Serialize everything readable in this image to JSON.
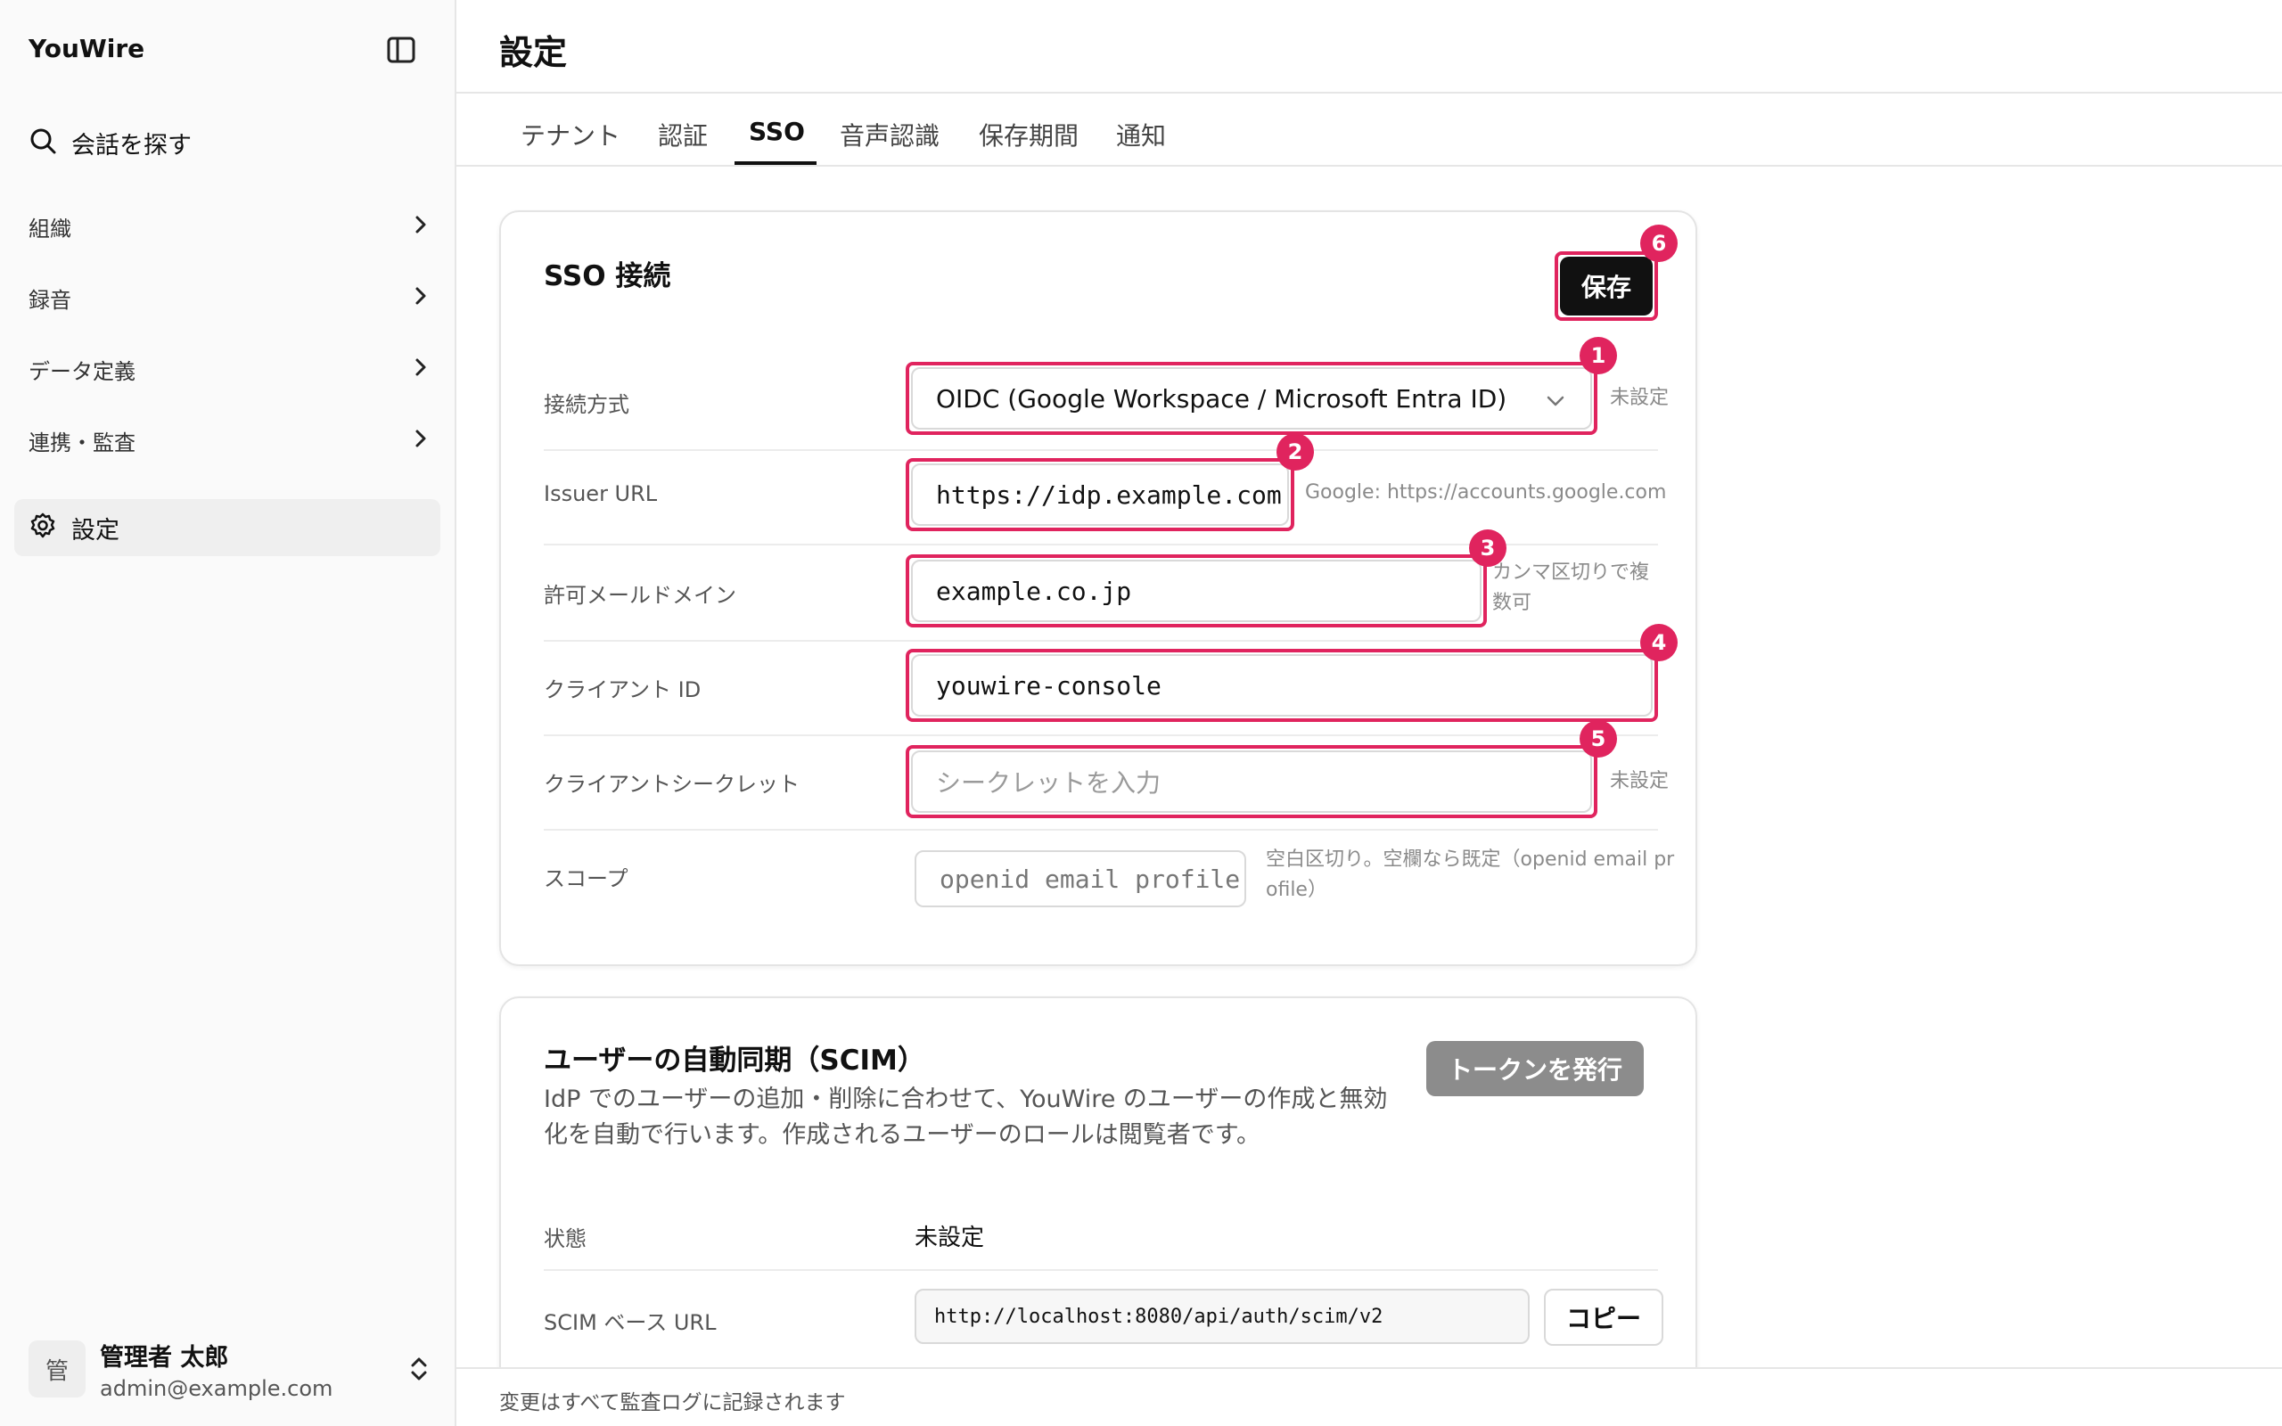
{
  "app": {
    "brand": "YouWire"
  },
  "sidebar": {
    "search_label": "会話を探す",
    "groups": [
      {
        "label": "組織"
      },
      {
        "label": "録音"
      },
      {
        "label": "データ定義"
      },
      {
        "label": "連携・監査"
      }
    ],
    "active_item": {
      "label": "設定",
      "icon": "gear-icon"
    },
    "user": {
      "avatar": "管",
      "name": "管理者 太郎",
      "email": "admin@example.com"
    }
  },
  "header": {
    "title": "設定"
  },
  "tabs": [
    {
      "label": "テナント"
    },
    {
      "label": "認証"
    },
    {
      "label": "SSO",
      "active": true
    },
    {
      "label": "音声認識"
    },
    {
      "label": "保存期間"
    },
    {
      "label": "通知"
    }
  ],
  "sso": {
    "title": "SSO 接続",
    "save_label": "保存",
    "rows": {
      "method": {
        "label": "接続方式",
        "value": "OIDC (Google Workspace / Microsoft Entra ID)",
        "hint": "未設定"
      },
      "issuer": {
        "label": "Issuer URL",
        "value": "https://idp.example.com",
        "hint": "Google: https://accounts.google.com"
      },
      "domain": {
        "label": "許可メールドメイン",
        "value": "example.co.jp",
        "hint_line1": "カンマ区切りで複",
        "hint_line2": "数可"
      },
      "client_id": {
        "label": "クライアント ID",
        "value": "youwire-console"
      },
      "secret": {
        "label": "クライアントシークレット",
        "placeholder": "シークレットを入力",
        "hint": "未設定"
      },
      "scope": {
        "label": "スコープ",
        "placeholder": "openid email profile",
        "hint_line1": "空白区切り。空欄なら既定（openid email pr",
        "hint_line2": "ofile）"
      }
    },
    "badges": [
      "1",
      "2",
      "3",
      "4",
      "5",
      "6"
    ],
    "highlight_color": "#e0245e"
  },
  "scim": {
    "title": "ユーザーの自動同期（SCIM）",
    "desc_line1": "IdP でのユーザーの追加・削除に合わせて、YouWire のユーザーの作成と無効",
    "desc_line2": "化を自動で行います。作成されるユーザーのロールは閲覧者です。",
    "token_button": "トークンを発行",
    "status_label": "状態",
    "status_value": "未設定",
    "base_url_label": "SCIM ベース URL",
    "base_url_value": "http://localhost:8080/api/auth/scim/v2",
    "copy_label": "コピー"
  },
  "footer": {
    "text": "変更はすべて監査ログに記録されます"
  }
}
